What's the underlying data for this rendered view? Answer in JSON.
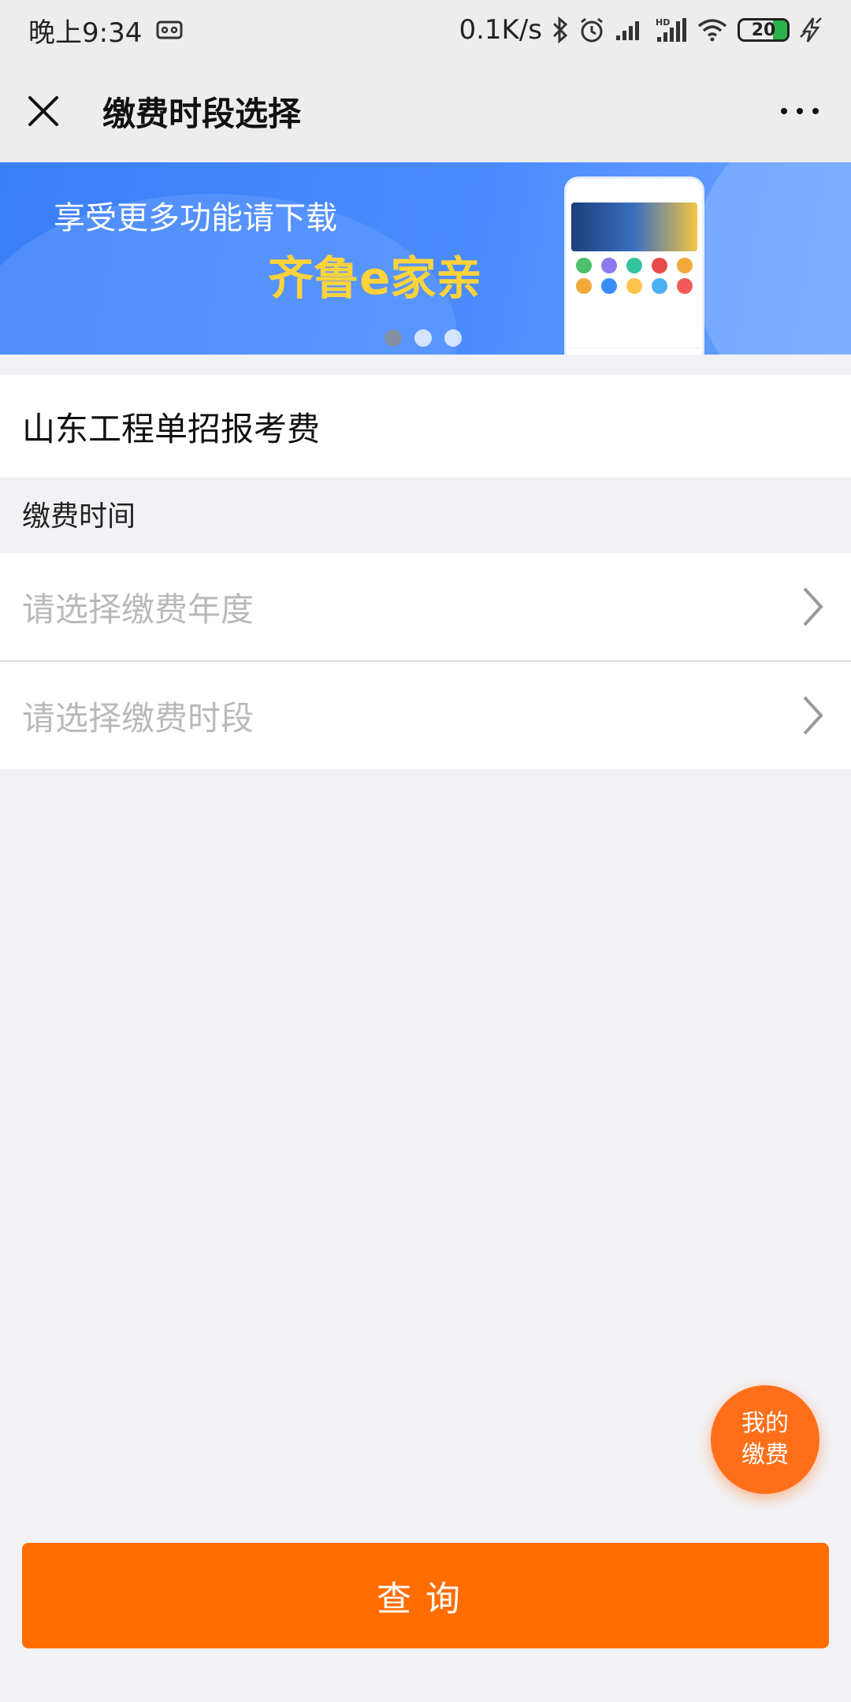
{
  "status_bar": {
    "time": "晚上9:34",
    "network_speed": "0.1K/s",
    "battery_level": "20",
    "icons": [
      "vr-icon",
      "bluetooth-icon",
      "alarm-icon",
      "signal-icon",
      "hd-signal-icon",
      "wifi-icon",
      "battery-icon",
      "charging-icon"
    ]
  },
  "nav": {
    "title": "缴费时段选择",
    "close_icon": "close-icon",
    "more_icon": "more-icon"
  },
  "banner": {
    "line1": "享受更多功能请下载",
    "line2": "齐鲁e家亲",
    "pages": 3,
    "active_page": 1
  },
  "item": {
    "title": "山东工程单招报考费"
  },
  "section": {
    "label": "缴费时间"
  },
  "selects": [
    {
      "placeholder": "请选择缴费年度"
    },
    {
      "placeholder": "请选择缴费时段"
    }
  ],
  "float_button": {
    "line1": "我的",
    "line2": "缴费"
  },
  "query_button": {
    "label": "查询"
  },
  "colors": {
    "accent": "#ff6d00",
    "banner_blue": "#3a7ff7",
    "banner_highlight": "#ffd33a",
    "placeholder": "#b9b9b9"
  }
}
